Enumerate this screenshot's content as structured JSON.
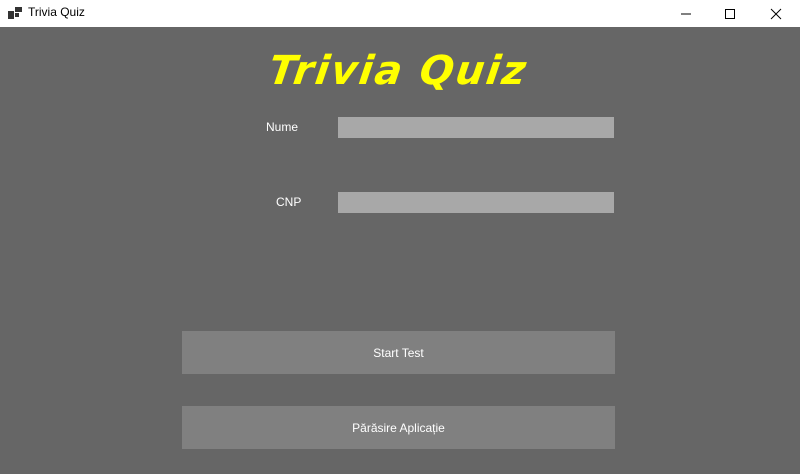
{
  "window": {
    "title": "Trivia Quiz",
    "icon": "app-icon",
    "controls": [
      "minimize-icon",
      "maximize-icon",
      "close-icon"
    ]
  },
  "main": {
    "heading": "Trivia Quiz",
    "fields": [
      {
        "label": "Nume",
        "value": "",
        "placeholder": ""
      },
      {
        "label": "CNP",
        "value": "",
        "placeholder": ""
      }
    ],
    "buttons": {
      "start": "Start Test",
      "exit": "Părăsire Aplicație"
    }
  },
  "colors": {
    "background": "#666666",
    "heading": "#ffff00",
    "input": "#a8a8a8",
    "button": "#808080",
    "text": "#ffffff"
  }
}
